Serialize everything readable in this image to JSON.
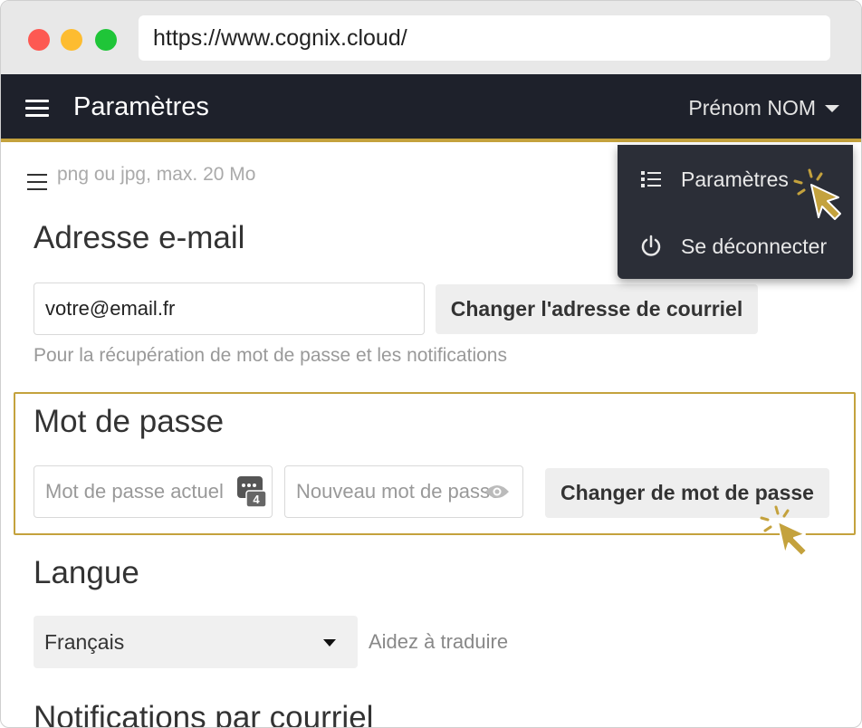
{
  "browser": {
    "url": "https://www.cognix.cloud/"
  },
  "topbar": {
    "title": "Paramètres",
    "user_name": "Prénom NOM"
  },
  "dropdown_menu": {
    "items": [
      {
        "label": "Paramètres",
        "icon": "list-icon"
      },
      {
        "label": "Se déconnecter",
        "icon": "power-icon"
      }
    ]
  },
  "avatar_section": {
    "hint_partial": "png ou jpg, max. 20 Mo"
  },
  "email_section": {
    "title": "Adresse e-mail",
    "email_value": "votre@email.fr",
    "change_button": "Changer l'adresse de courriel",
    "hint": "Pour la récupération de mot de passe et les notifications"
  },
  "password_section": {
    "title": "Mot de passe",
    "current_placeholder": "Mot de passe actuel",
    "new_placeholder": "Nouveau mot de passe",
    "badge_number": "4",
    "change_button": "Changer de mot de passe"
  },
  "language_section": {
    "title": "Langue",
    "selected": "Français",
    "help_link": "Aidez à traduire"
  },
  "notifications_section": {
    "title": "Notifications par courriel"
  },
  "colors": {
    "topbar_bg": "#1e212b",
    "accent_gold": "#c4a23d",
    "dropdown_bg": "#2b2e37"
  }
}
